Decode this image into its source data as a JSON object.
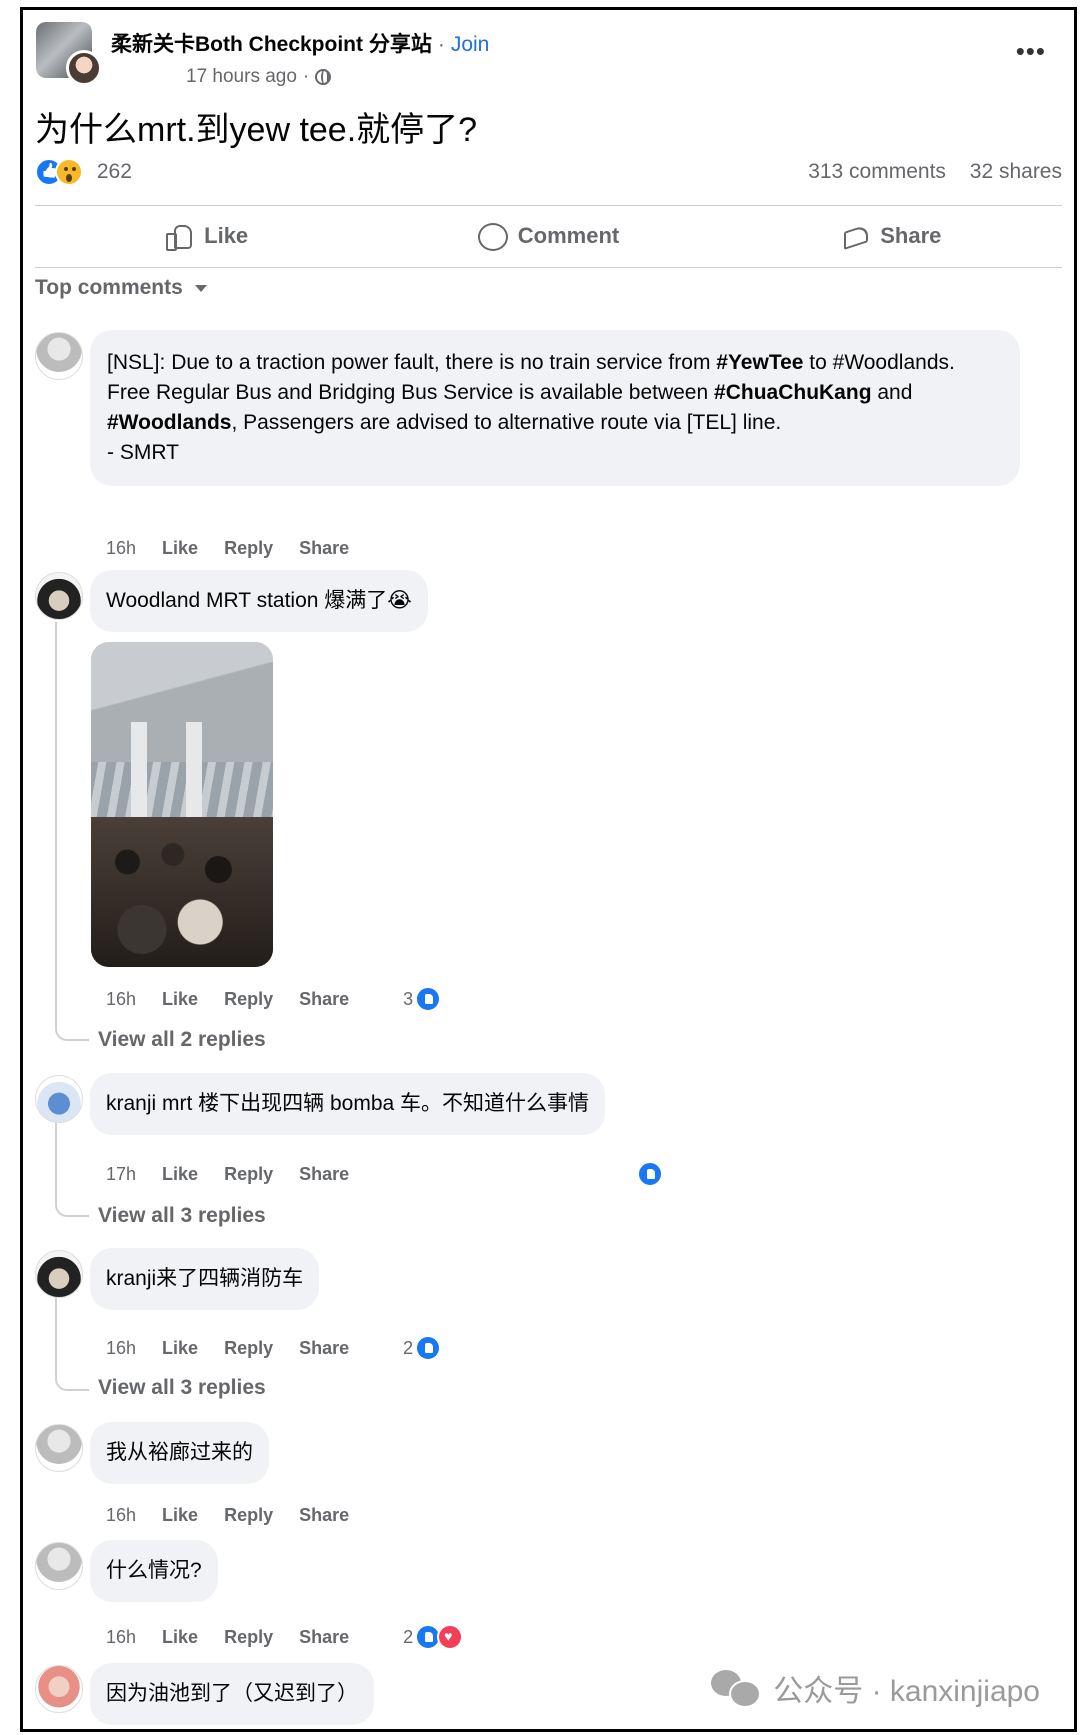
{
  "post": {
    "group_name": "柔新关卡Both Checkpoint 分享站",
    "separator": "·",
    "join_label": "Join",
    "time": "17 hours ago",
    "meta_separator": "·",
    "text": "为什么mrt.到yew tee.就停了?",
    "reaction_count": "262",
    "comments_count": "313 comments",
    "shares_count": "32 shares",
    "reaction_icons": [
      "like-icon",
      "wow-icon"
    ]
  },
  "actions": {
    "like": "Like",
    "comment": "Comment",
    "share": "Share"
  },
  "comments_header": "Top comments",
  "comments": [
    {
      "segments": [
        {
          "t": "[NSL]: Due to a traction power fault, there is no train service from ",
          "b": false
        },
        {
          "t": "#YewTee",
          "b": true
        },
        {
          "t": " to #Woodlands. Free Regular Bus and Bridging Bus Service is available between ",
          "b": false
        },
        {
          "t": "#ChuaChuKang",
          "b": true
        },
        {
          "t": " and ",
          "b": false
        },
        {
          "t": "#Woodlands",
          "b": true
        },
        {
          "t": ", Passengers are advised to alternative route via [TEL] line.",
          "b": false
        }
      ],
      "signoff": "- SMRT",
      "time": "16h",
      "like": "Like",
      "reply": "Reply",
      "share": "Share"
    },
    {
      "text": "Woodland MRT station 爆满了😭",
      "time": "16h",
      "like": "Like",
      "reply": "Reply",
      "share": "Share",
      "reactions": "3",
      "view_replies": "View all 2 replies"
    },
    {
      "text": "kranji mrt 楼下出现四辆 bomba 车。不知道什么事情",
      "time": "17h",
      "like": "Like",
      "reply": "Reply",
      "share": "Share",
      "reactions": "",
      "view_replies": "View all 3 replies"
    },
    {
      "text": "kranji来了四辆消防车",
      "time": "16h",
      "like": "Like",
      "reply": "Reply",
      "share": "Share",
      "reactions": "2",
      "view_replies": "View all 3 replies"
    },
    {
      "text": "我从裕廊过来的",
      "time": "16h",
      "like": "Like",
      "reply": "Reply",
      "share": "Share"
    },
    {
      "text": "什么情况?",
      "time": "16h",
      "like": "Like",
      "reply": "Reply",
      "share": "Share",
      "reactions": "2"
    },
    {
      "text": "因为油池到了（又迟到了）"
    }
  ],
  "watermark": {
    "text": "公众号 · kanxinjiapo",
    "icon": "wechat-icon"
  },
  "colors": {
    "link": "#216fdb",
    "muted": "#65676b",
    "bubble": "#f0f2f5",
    "like_blue": "#1877f2",
    "love_red": "#f33e58"
  }
}
